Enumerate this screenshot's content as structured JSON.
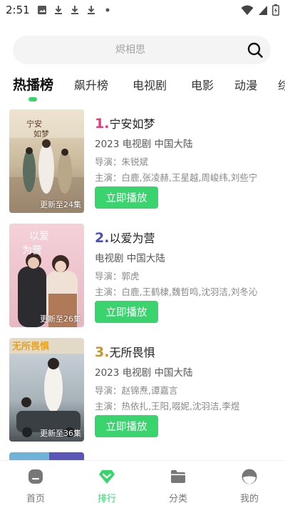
{
  "status_bar": {
    "time": "2:51",
    "left_icons": [
      "image-icon",
      "download-icon",
      "download-icon",
      "download-icon",
      "dot-icon"
    ],
    "right_icons": [
      "wifi-icon",
      "signal-icon",
      "battery-icon"
    ]
  },
  "search": {
    "placeholder": "烬相思"
  },
  "tabs": [
    {
      "label": "热播榜",
      "active": true
    },
    {
      "label": "飙升榜",
      "active": false
    },
    {
      "label": "电视剧",
      "active": false
    },
    {
      "label": "电影",
      "active": false
    },
    {
      "label": "动漫",
      "active": false
    },
    {
      "label": "综",
      "active": false
    }
  ],
  "items": [
    {
      "rank": "1.",
      "rank_color": "#e63a7c",
      "title": "宁安如梦",
      "meta": "2023  电视剧  中国大陆",
      "director": "导演：朱锐斌",
      "cast": "主演：白鹿,张凌赫,王星越,周峻纬,刘些宁",
      "update": "更新至24集",
      "play_label": "立即播放"
    },
    {
      "rank": "2.",
      "rank_color": "#4a4fb8",
      "title": "以爱为营",
      "meta": " 电视剧  中国大陆",
      "director": "导演：郭虎",
      "cast": "主演：白鹿,王鹤棣,魏哲鸣,沈羽洁,刘冬沁",
      "update": "更新至26集",
      "play_label": "立即播放"
    },
    {
      "rank": "3.",
      "rank_color": "#c9962e",
      "title": "无所畏惧",
      "meta": "2023  电视剧  中国大陆",
      "director": "导演：赵锦焘,谭嘉言",
      "cast": "主演：热依扎,王阳,啜妮,沈羽洁,李煜",
      "update": "更新至36集",
      "play_label": "立即播放"
    }
  ],
  "bottom_nav": [
    {
      "label": "首页",
      "icon": "home-icon",
      "active": false
    },
    {
      "label": "排行",
      "icon": "ranking-icon",
      "active": true
    },
    {
      "label": "分类",
      "icon": "folder-icon",
      "active": false
    },
    {
      "label": "我的",
      "icon": "profile-icon",
      "active": false
    }
  ],
  "colors": {
    "accent": "#3ad46f",
    "search_bg": "#f3f4f3"
  }
}
